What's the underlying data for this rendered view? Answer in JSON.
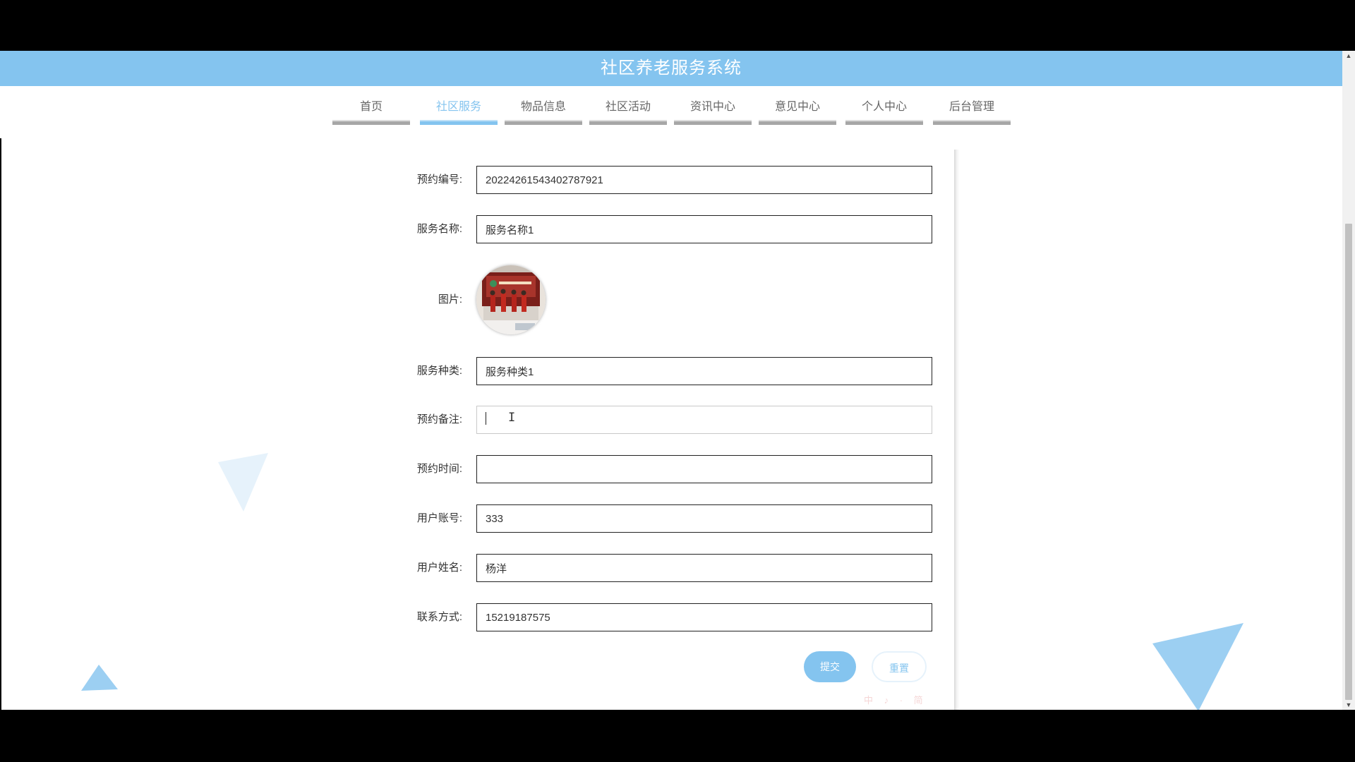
{
  "app": {
    "title": "社区养老服务系统"
  },
  "nav": [
    {
      "label": "首页",
      "active": false
    },
    {
      "label": "社区服务",
      "active": true
    },
    {
      "label": "物品信息",
      "active": false
    },
    {
      "label": "社区活动",
      "active": false
    },
    {
      "label": "资讯中心",
      "active": false
    },
    {
      "label": "意见中心",
      "active": false
    },
    {
      "label": "个人中心",
      "active": false
    },
    {
      "label": "后台管理",
      "active": false
    }
  ],
  "form": {
    "booking_no": {
      "label": "预约编号:",
      "value": "20224261543402787921"
    },
    "service_name": {
      "label": "服务名称:",
      "value": "服务名称1"
    },
    "image": {
      "label": "图片:"
    },
    "service_type": {
      "label": "服务种类:",
      "value": "服务种类1"
    },
    "booking_note": {
      "label": "预约备注:",
      "value": ""
    },
    "booking_time": {
      "label": "预约时间:",
      "value": ""
    },
    "user_account": {
      "label": "用户账号:",
      "value": "333"
    },
    "user_name": {
      "label": "用户姓名:",
      "value": "杨洋"
    },
    "contact": {
      "label": "联系方式:",
      "value": "15219187575"
    }
  },
  "buttons": {
    "submit": "提交",
    "reset": "重置"
  },
  "ime": {
    "text": "中 ♪ · 简"
  },
  "colors": {
    "accent": "#84c4ef",
    "nav_text": "#666666"
  }
}
